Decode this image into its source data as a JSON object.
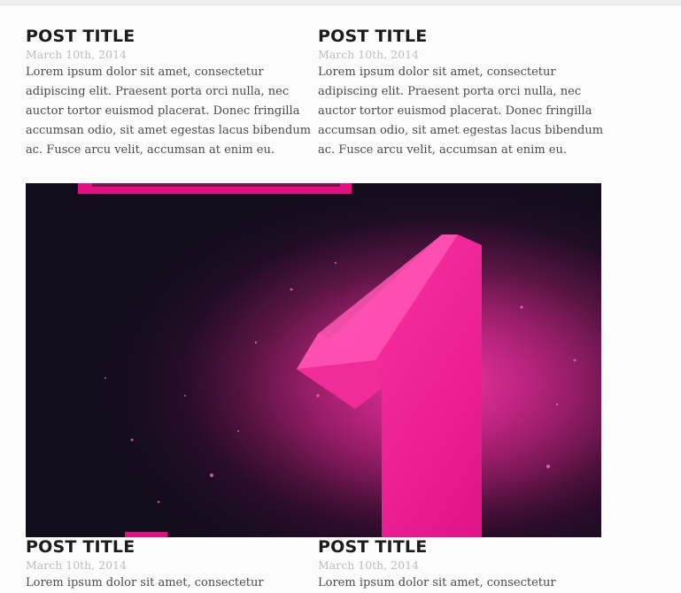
{
  "posts": [
    {
      "title": "POST TITLE",
      "date": "March 10th, 2014",
      "body": "Lorem ipsum dolor sit amet, consectetur\nadipiscing elit. Praesent porta orci nulla, nec\nauctor tortor euismod placerat. Donec fringilla\naccumsan odio, sit amet egestas lacus bibendum\nac. Fusce arcu velit, accumsan at enim eu."
    },
    {
      "title": "POST TITLE",
      "date": "March 10th, 2014",
      "body": "Lorem ipsum dolor sit amet, consectetur\nadipiscing elit. Praesent porta orci nulla, nec\nauctor tortor euismod placerat. Donec fringilla\naccumsan odio, sit amet egestas lacus bibendum\nac. Fusce arcu velit, accumsan at enim eu."
    },
    {
      "title": "POST TITLE",
      "date": "March 10th, 2014",
      "body": "Lorem ipsum dolor sit amet, consectetur"
    },
    {
      "title": "POST TITLE",
      "date": "March 10th, 2014",
      "body": "Lorem ipsum dolor sit amet, consectetur"
    }
  ],
  "hero": {
    "accent_color": "#e10f82",
    "background_color": "#120c1c"
  }
}
